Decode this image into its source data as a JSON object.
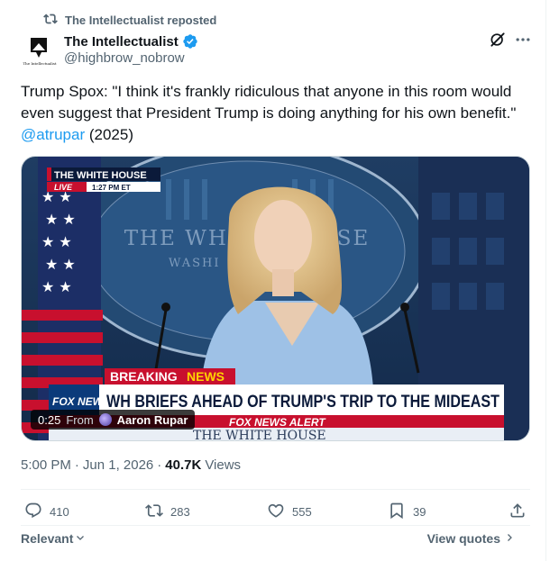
{
  "repost": {
    "label": "The Intellectualist reposted",
    "icon": "repost-icon"
  },
  "author": {
    "name": "The Intellectualist",
    "handle": "@highbrow_nobrow",
    "verified": true,
    "avatar_caption": "The Intellectualist"
  },
  "tweet": {
    "text": "Trump Spox: \"I think it's frankly ridiculous that anyone in this room would even suggest that President Trump is doing anything for his own benefit.\"",
    "mention": "@atrupar",
    "year": "(2025)"
  },
  "video": {
    "duration": "0:25",
    "from_label": "From",
    "source_name": "Aaron Rupar",
    "broadcast": {
      "location": "THE WHITE HOUSE",
      "live": "LIVE",
      "time": "1:27 PM ET",
      "breaking": "BREAKING",
      "news": "NEWS",
      "headline": "WH BRIEFS AHEAD OF TRUMP'S TRIP TO THE MIDEAST",
      "network": "FOX NEWS",
      "alert": "FOX NEWS ALERT",
      "backdrop_text": "THE WHITE HOUSE",
      "backdrop_lower": "THE WHITE HOUSE",
      "washington": "WASHI"
    }
  },
  "meta": {
    "time": "5:00 PM",
    "dot": "·",
    "date": "Jun 1, 2026",
    "views_count": "40.7K",
    "views_label": "Views"
  },
  "actions": {
    "replies": "410",
    "reposts": "283",
    "likes": "555",
    "bookmarks": "39"
  },
  "footer": {
    "sort_label": "Relevant",
    "quotes_label": "View quotes"
  },
  "colors": {
    "accent": "#1d9bf0",
    "muted": "#536471",
    "text": "#0f1419",
    "fox_red": "#c8102e"
  }
}
